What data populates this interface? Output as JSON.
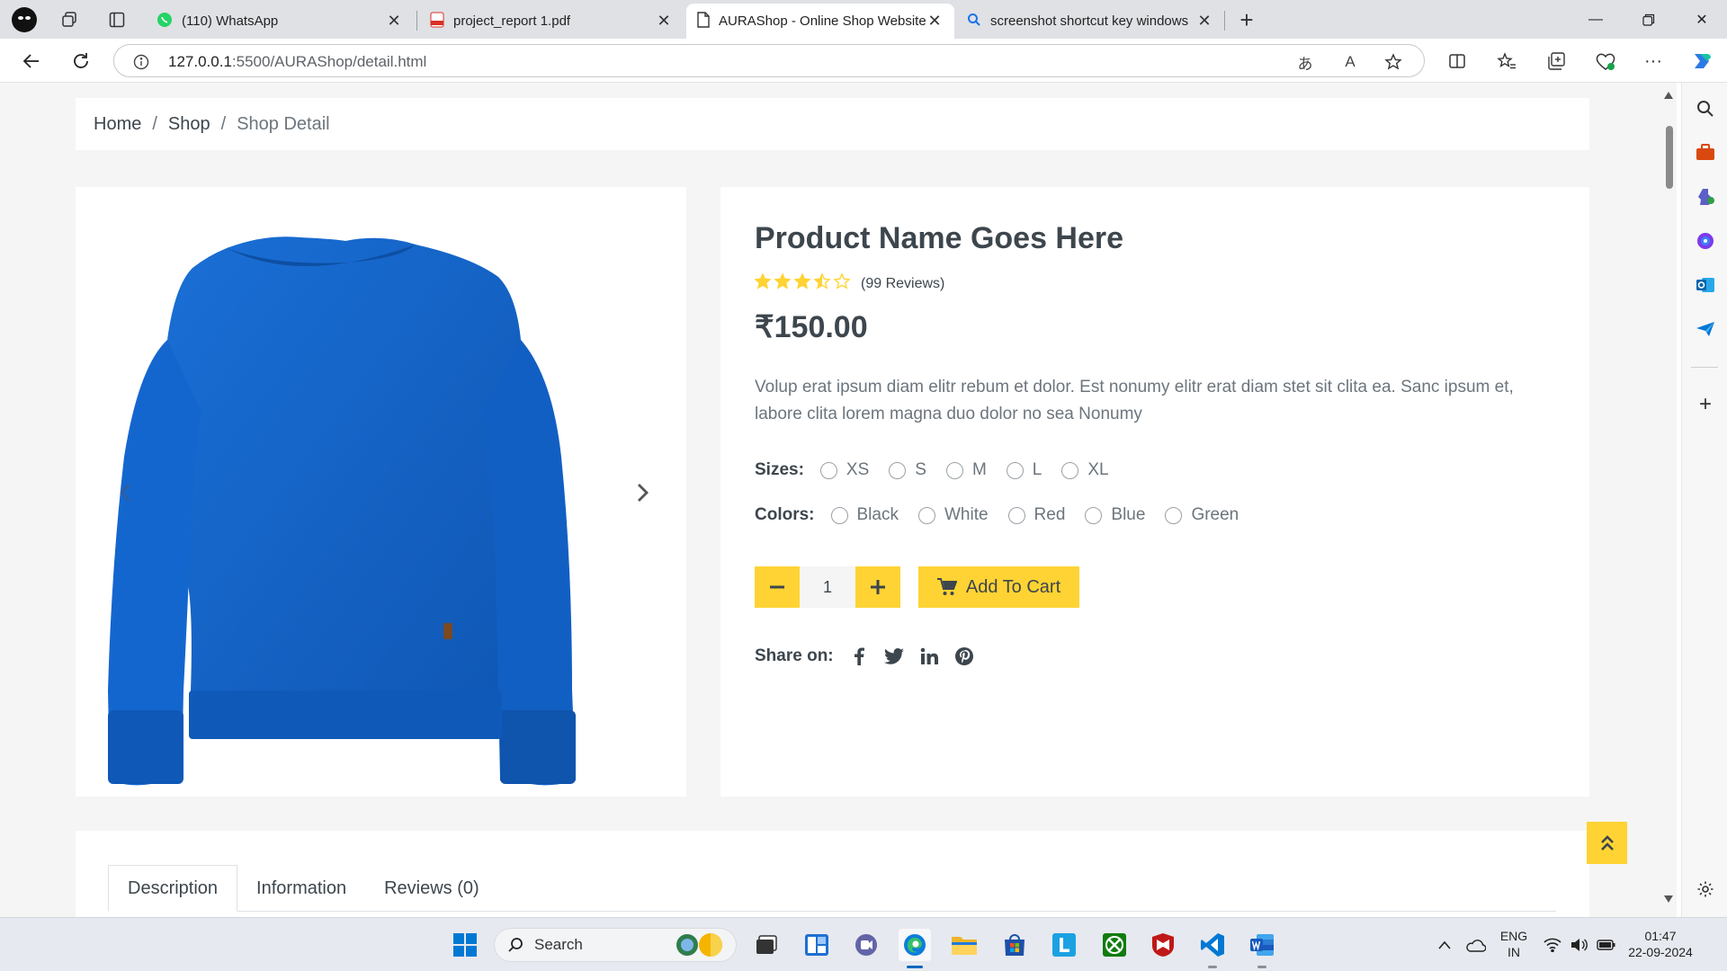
{
  "browser": {
    "tabs": [
      {
        "title": "(110) WhatsApp",
        "icon": "whatsapp-icon"
      },
      {
        "title": "project_report 1.pdf",
        "icon": "pdf-icon"
      },
      {
        "title": "AURAShop - Online Shop Website",
        "icon": "page-icon",
        "active": true
      },
      {
        "title": "screenshot shortcut key windows",
        "icon": "search-icon"
      }
    ],
    "url_host": "127.0.0.1",
    "url_path": ":5500/AURAShop/detail.html"
  },
  "breadcrumb": {
    "home": "Home",
    "shop": "Shop",
    "current": "Shop Detail",
    "separator": "/"
  },
  "product": {
    "name": "Product Name Goes Here",
    "rating": 3.5,
    "rating_max": 5,
    "reviews": "(99 Reviews)",
    "price": "₹150.00",
    "description": "Volup erat ipsum diam elitr rebum et dolor. Est nonumy elitr erat diam stet sit clita ea. Sanc ipsum et, labore clita lorem magna duo dolor no sea Nonumy",
    "sizes_label": "Sizes:",
    "sizes": [
      "XS",
      "S",
      "M",
      "L",
      "XL"
    ],
    "colors_label": "Colors:",
    "colors": [
      "Black",
      "White",
      "Red",
      "Blue",
      "Green"
    ],
    "quantity": "1",
    "add_to_cart": "Add To Cart",
    "share_label": "Share on:",
    "image_color": "#1363c6"
  },
  "tabs": {
    "description": "Description",
    "information": "Information",
    "reviews": "Reviews (0)"
  },
  "theme": {
    "accent": "#ffd333",
    "star": "#ffd333",
    "text": "#3d464d"
  },
  "taskbar": {
    "search_label": "Search",
    "lang_line1": "ENG",
    "lang_line2": "IN",
    "time": "01:47",
    "date": "22-09-2024"
  }
}
